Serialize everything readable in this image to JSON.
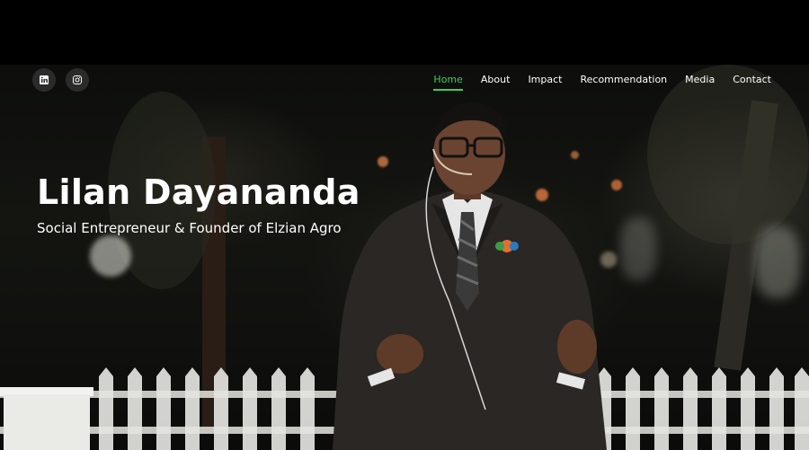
{
  "site": {
    "name": "Lilan Dayananda",
    "tagline": "Social Entrepreneur & Founder of Elzian Agro"
  },
  "social": [
    {
      "icon": "linkedin-icon",
      "label": "LinkedIn"
    },
    {
      "icon": "instagram-icon",
      "label": "Instagram"
    }
  ],
  "nav": {
    "items": [
      "Home",
      "About",
      "Impact",
      "Recommendation",
      "Media",
      "Contact"
    ],
    "active": "Home",
    "accent": "#3ccf5a"
  },
  "hero": {
    "background": "dark night scene with white picket fence",
    "subject": "speaker in dark suit with headset microphone"
  }
}
